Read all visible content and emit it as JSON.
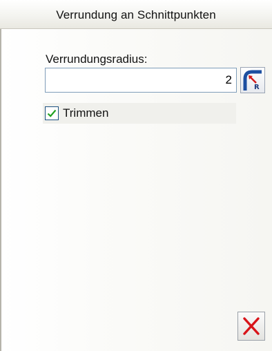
{
  "window": {
    "title": "Verrundung an Schnittpunkten"
  },
  "radius": {
    "label": "Verrundungsradius:",
    "value": "2",
    "pick_icon": "fillet-radius-pick-icon"
  },
  "trim": {
    "label": "Trimmen",
    "checked": true
  },
  "actions": {
    "cancel_icon": "close-icon"
  },
  "colors": {
    "title_bg": "#f4f4f0",
    "input_border": "#7f9db9",
    "pick_icon_blue": "#1d4fa0",
    "pick_icon_red": "#d21a1a",
    "cancel_red": "#d8141a"
  }
}
